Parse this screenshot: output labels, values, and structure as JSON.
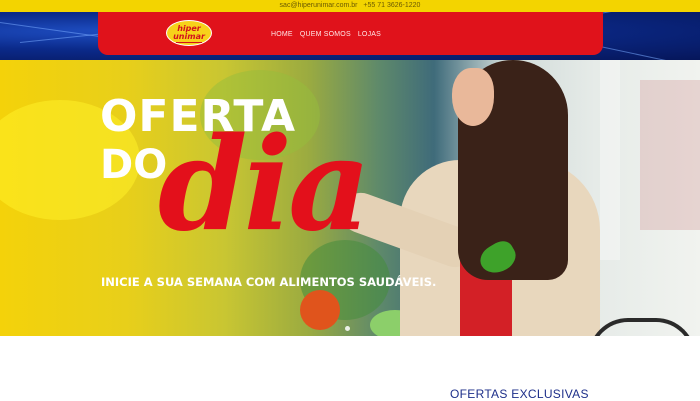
{
  "topbar": {
    "email": "sac@hiperunimar.com.br",
    "phone": "+55 71 3626-1220"
  },
  "logo": {
    "line1": "hiper",
    "line2": "unimar"
  },
  "nav": {
    "items": [
      {
        "label": "HOME"
      },
      {
        "label": "QUEM SOMOS"
      },
      {
        "label": "LOJAS"
      }
    ]
  },
  "hero": {
    "title_line1": "OFERTA",
    "title_line2": "DO",
    "title_script": "dia",
    "subtitle": "INICIE A SUA SEMANA COM ALIMENTOS SAUDÁVEIS."
  },
  "section": {
    "title": "OFERTAS EXCLUSIVAS"
  },
  "colors": {
    "topbar": "#f3d400",
    "nav_red": "#e0121b",
    "nav_blue": "#0b2a8a",
    "script_red": "#e3101b",
    "section_blue": "#1d2f8a"
  }
}
